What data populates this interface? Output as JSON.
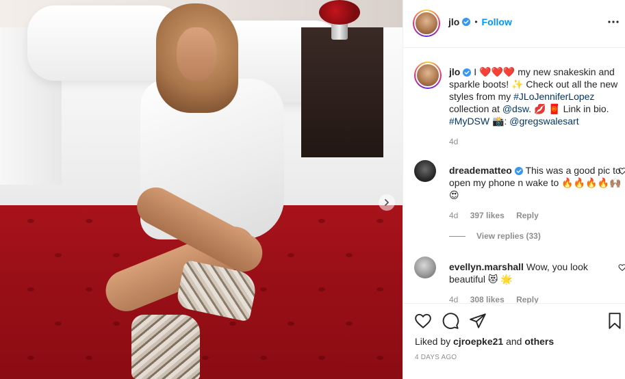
{
  "photo": {
    "next_icon": "chevron-right-icon"
  },
  "header": {
    "username": "jlo",
    "separator": "•",
    "follow_label": "Follow",
    "more_icon": "more-options-icon"
  },
  "caption": {
    "username": "jlo",
    "text_part1": " I ❤️❤️❤️ my new snakeskin and sparkle boots! ✨ Check out all the new styles from my ",
    "hashtag1": "#JLoJenniferLopez",
    "text_part2": " collection at ",
    "mention1": "@dsw",
    "text_part3": ". 💋 🧧 Link in bio. ",
    "hashtag2": "#MyDSW",
    "text_part4": " 📸: ",
    "mention2": "@gregswalesart",
    "time": "4d"
  },
  "comments": [
    {
      "username": "dreadematteo",
      "verified": true,
      "text": " This was a good pic to open my phone n wake to 🔥🔥🔥🔥🙌🏽😍",
      "time": "4d",
      "likes": "397 likes",
      "reply": "Reply"
    },
    {
      "username": "evellyn.marshall",
      "verified": false,
      "text": " Wow, you look beautiful 😻 🌟",
      "time": "4d",
      "likes": "308 likes",
      "reply": "Reply"
    }
  ],
  "view_replies": "View replies (33)",
  "actions": {
    "liked_prefix": "Liked by ",
    "liked_user": "cjroepke21",
    "liked_mid": " and ",
    "liked_others": "others",
    "timestamp": "4 DAYS AGO"
  },
  "colors": {
    "link": "#00376b",
    "follow": "#0095f6",
    "muted": "#8e8e8e",
    "verified": "#3897f0"
  }
}
